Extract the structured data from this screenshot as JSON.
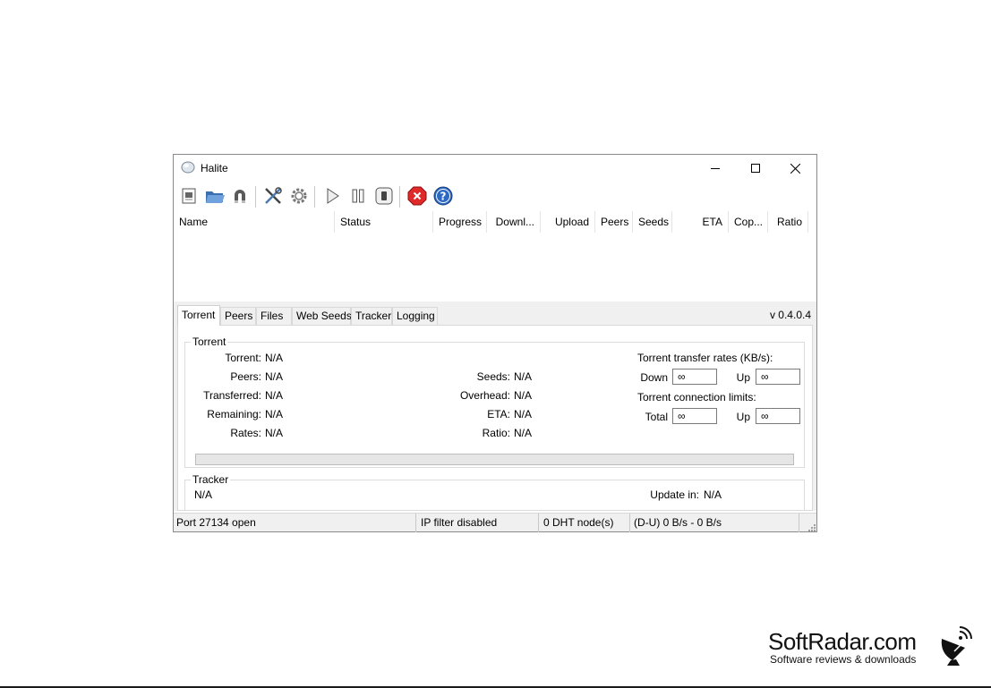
{
  "window": {
    "title": "Halite",
    "icon": "halite-app-icon",
    "buttons": [
      "minimize-icon",
      "maximize-icon",
      "close-icon"
    ]
  },
  "toolbar": {
    "items": [
      {
        "icon": "open-torrent-icon"
      },
      {
        "icon": "open-folder-icon"
      },
      {
        "icon": "magnet-icon"
      },
      {
        "icon": "settings-tools-icon"
      },
      {
        "icon": "gear-icon"
      },
      {
        "icon": "play-icon"
      },
      {
        "icon": "pause-icon"
      },
      {
        "icon": "stop-icon"
      },
      {
        "icon": "remove-icon"
      },
      {
        "icon": "help-icon"
      }
    ]
  },
  "list": {
    "columns": [
      "Name",
      "Status",
      "Progress",
      "Downl...",
      "Upload",
      "Peers",
      "Seeds",
      "ETA",
      "Cop...",
      "Ratio"
    ],
    "rows": []
  },
  "tabs": {
    "items": [
      "Torrent",
      "Peers",
      "Files",
      "Web Seeds",
      "Tracker",
      "Logging"
    ],
    "active": "Torrent"
  },
  "version": "v 0.4.0.4",
  "torrent_group": {
    "title": "Torrent",
    "left": [
      {
        "label": "Torrent:",
        "value": "N/A"
      },
      {
        "label": "Peers:",
        "value": "N/A"
      },
      {
        "label": "Transferred:",
        "value": "N/A"
      },
      {
        "label": "Remaining:",
        "value": "N/A"
      },
      {
        "label": "Rates:",
        "value": "N/A"
      }
    ],
    "middle": [
      {
        "label": "Seeds:",
        "value": "N/A"
      },
      {
        "label": "Overhead:",
        "value": "N/A"
      },
      {
        "label": "ETA:",
        "value": "N/A"
      },
      {
        "label": "Ratio:",
        "value": "N/A"
      }
    ],
    "rates_title": "Torrent transfer rates (KB/s):",
    "down_label": "Down",
    "down_value": "∞",
    "up_label": "Up",
    "up_value": "∞",
    "limits_title": "Torrent connection limits:",
    "total_label": "Total",
    "total_value": "∞",
    "limit_up_label": "Up",
    "limit_up_value": "∞",
    "progress": 0
  },
  "tracker_group": {
    "title": "Tracker",
    "value": "N/A",
    "update_label": "Update in:",
    "update_value": "N/A"
  },
  "statusbar": {
    "port": "Port 27134 open",
    "ipfilter": "IP filter disabled",
    "dht": "0 DHT node(s)",
    "rates": "(D-U) 0 B/s - 0 B/s"
  },
  "watermark": {
    "name": "SoftRadar.com",
    "tagline": "Software reviews & downloads",
    "icon": "satellite-dish-icon"
  }
}
